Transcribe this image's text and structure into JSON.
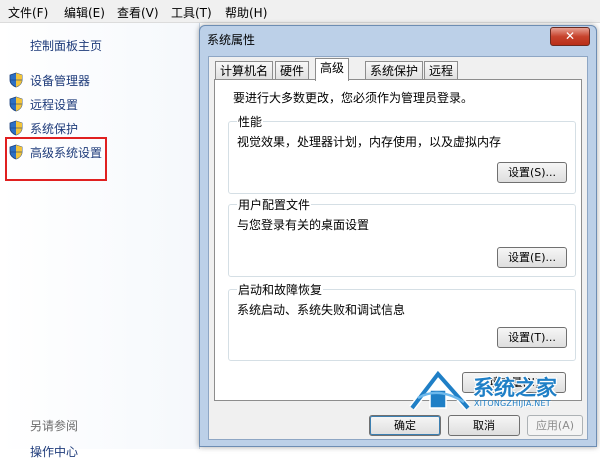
{
  "menu": [
    {
      "label": "文件(F)"
    },
    {
      "label": "编辑(E)"
    },
    {
      "label": "查看(V)"
    },
    {
      "label": "工具(T)"
    },
    {
      "label": "帮助(H)"
    }
  ],
  "nav": {
    "home": "控制面板主页",
    "links": [
      {
        "label": "设备管理器",
        "icon": "shield-icon"
      },
      {
        "label": "远程设置",
        "icon": "shield-icon"
      },
      {
        "label": "系统保护",
        "icon": "shield-icon"
      },
      {
        "label": "高级系统设置",
        "icon": "shield-icon"
      }
    ],
    "see_also": "另请参阅",
    "partial_link": "操作中心"
  },
  "dialog": {
    "title": "系统属性",
    "close_symbol": "✕",
    "tabs": [
      {
        "label": "计算机名"
      },
      {
        "label": "硬件"
      },
      {
        "label": "高级",
        "active": true
      },
      {
        "label": "系统保护"
      },
      {
        "label": "远程"
      }
    ],
    "admin_note": "要进行大多数更改，您必须作为管理员登录。",
    "groups": [
      {
        "title": "性能",
        "desc": "视觉效果，处理器计划，内存使用，以及虚拟内存",
        "button": "设置(S)..."
      },
      {
        "title": "用户配置文件",
        "desc": "与您登录有关的桌面设置",
        "button": "设置(E)..."
      },
      {
        "title": "启动和故障恢复",
        "desc": "系统启动、系统失败和调试信息",
        "button": "设置(T)..."
      }
    ],
    "env_button": "环境变量(N)...",
    "ok": "确定",
    "cancel": "取消",
    "apply": "应用(A)"
  },
  "watermark": {
    "brand": "系统之家",
    "url": "XITONGZHIJIA.NET"
  },
  "colors": {
    "highlight": "#e02020",
    "link": "#1e3b7a",
    "watermark": "#1f7fc6"
  }
}
